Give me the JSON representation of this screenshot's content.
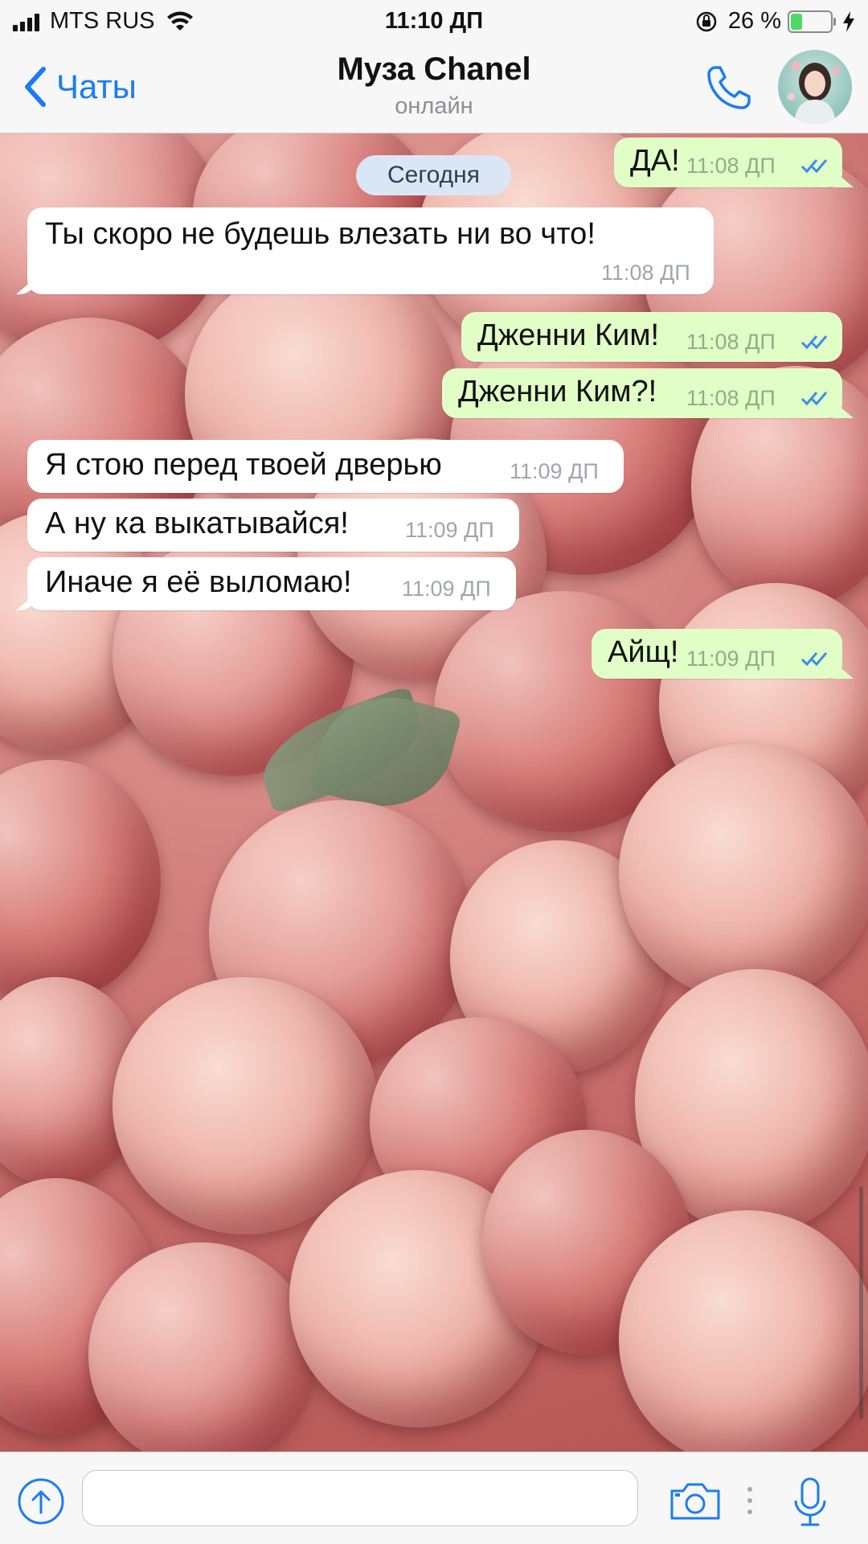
{
  "status_bar": {
    "carrier": "MTS RUS",
    "time": "11:10 ДП",
    "battery_percent": "26 %",
    "battery_level": 0.26
  },
  "header": {
    "back_label": "Чаты",
    "title": "Муза Chanel",
    "subtitle": "онлайн"
  },
  "date_divider": "Сегодня",
  "messages": [
    {
      "direction": "out",
      "text": "ДА!",
      "time": "11:08 ДП",
      "read": true
    },
    {
      "direction": "in",
      "text": "Ты скоро не будешь влезать ни во что!",
      "time": "11:08 ДП"
    },
    {
      "direction": "out",
      "text": "Дженни Ким!",
      "time": "11:08 ДП",
      "read": true
    },
    {
      "direction": "out",
      "text": "Дженни Ким?!",
      "time": "11:08 ДП",
      "read": true
    },
    {
      "direction": "in",
      "text": "Я стою перед твоей дверью",
      "time": "11:09 ДП"
    },
    {
      "direction": "in",
      "text": "А ну ка выкатывайся!",
      "time": "11:09 ДП"
    },
    {
      "direction": "in",
      "text": "Иначе я её выломаю!",
      "time": "11:09 ДП"
    },
    {
      "direction": "out",
      "text": "Айщ!",
      "time": "11:09 ДП",
      "read": true
    }
  ],
  "input": {
    "value": "",
    "placeholder": ""
  },
  "colors": {
    "accent": "#1a7cf5",
    "outgoing_bubble": "#e1fec6",
    "incoming_bubble": "#ffffff",
    "date_pill": "#dbe6f5"
  }
}
